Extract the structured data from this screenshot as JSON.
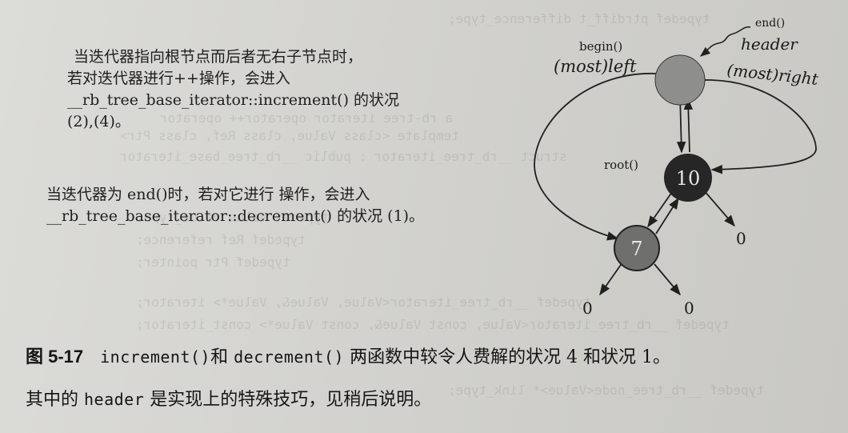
{
  "note1": {
    "line1": "当迭代器指向根节点而后者无右子节点时，",
    "line2": "若对迭代器进行++操作，会进入",
    "line3": "__rb_tree_base_iterator::increment() 的状况",
    "line4": "(2),(4)。"
  },
  "note2": {
    "line1": "当迭代器为 end()时，若对它进行 操作，会进入",
    "line2": "__rb_tree_base_iterator::decrement() 的状况 (1)。"
  },
  "diagram": {
    "label_end": "end()",
    "label_header": "header",
    "label_begin": "begin()",
    "label_leftmost": "(most)left",
    "label_rightmost": "(most)right",
    "label_root": "root()",
    "node_root": "10",
    "node_left": "7",
    "null_labels": [
      "0",
      "0",
      "0"
    ],
    "colors": {
      "header_node": "#8e8e8c",
      "black_node": "#262626",
      "red_node": "#6f6f6d"
    }
  },
  "caption": {
    "fig_label": "图 5-17",
    "fn1": "increment()",
    "and": "和",
    "fn2": "decrement()",
    "text1": "两函数中较令人费解的状况 4 和状况 1。",
    "text2_a": "其中的",
    "code_header": "header",
    "text2_b": "是实现上的特殊技巧，见稍后说明。"
  }
}
